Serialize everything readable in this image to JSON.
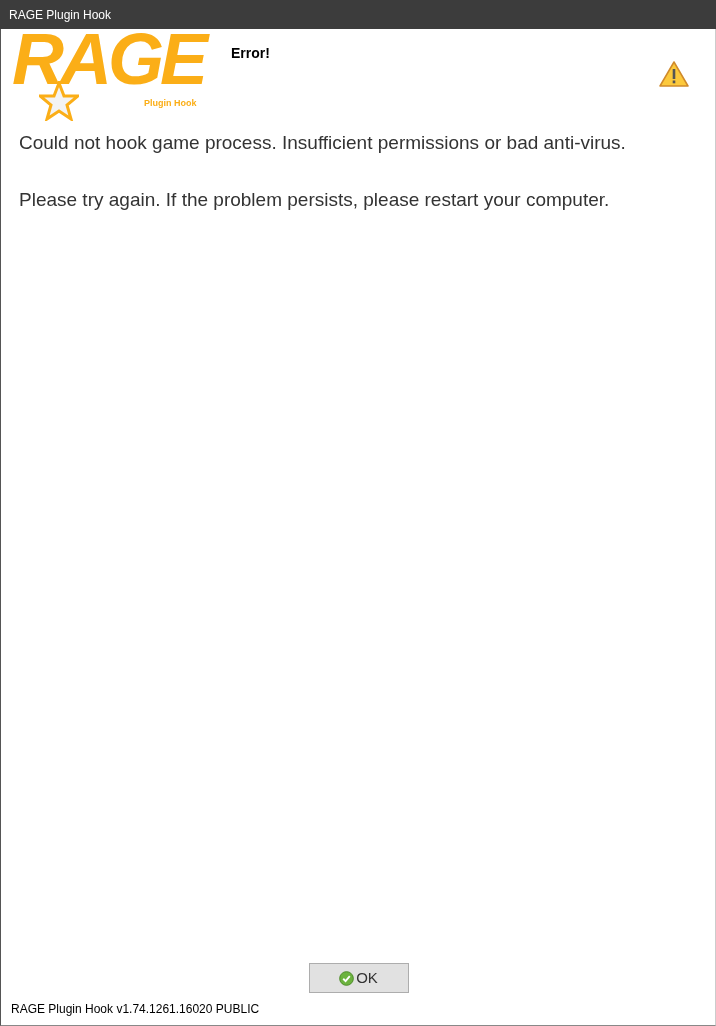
{
  "window": {
    "title": "RAGE Plugin Hook"
  },
  "logo": {
    "wordmark": "RAGE",
    "subtitle": "Plugin Hook"
  },
  "heading": "Error!",
  "messages": [
    "Could not hook game process. Insufficient permissions or bad anti-virus.",
    "Please try again. If the problem persists, please restart your computer."
  ],
  "buttons": [
    {
      "label": "OK"
    }
  ],
  "status_bar": {
    "text": "RAGE Plugin Hook v1.74.1261.16020 PUBLIC"
  }
}
